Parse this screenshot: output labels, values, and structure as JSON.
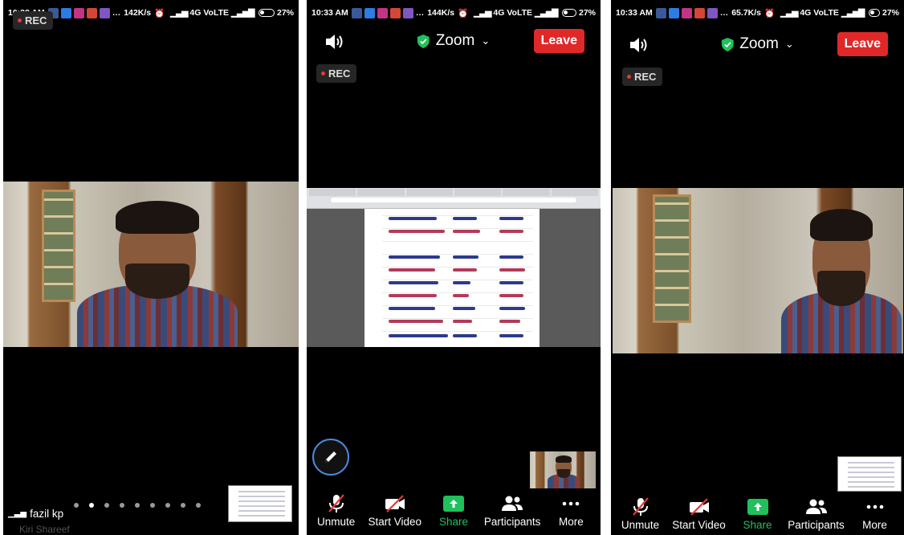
{
  "phones": {
    "left": {
      "status": {
        "time": "10:33 AM",
        "speed": "142K/s",
        "network": "4G VoLTE",
        "battery": "27%"
      },
      "rec": "REC",
      "participant_name": "fazil kp",
      "partial_name": "Kiri Shareef",
      "page_dots": {
        "count": 9,
        "active_index": 1
      }
    },
    "middle": {
      "status": {
        "time": "10:33 AM",
        "speed": "144K/s",
        "network": "4G VoLTE",
        "battery": "27%"
      },
      "app_title": "Zoom",
      "leave_label": "Leave",
      "rec": "REC",
      "toolbar": {
        "unmute": "Unmute",
        "start_video": "Start Video",
        "share": "Share",
        "participants": "Participants",
        "more": "More"
      }
    },
    "right": {
      "status": {
        "time": "10:33 AM",
        "speed": "65.7K/s",
        "network": "4G VoLTE",
        "battery": "27%"
      },
      "app_title": "Zoom",
      "leave_label": "Leave",
      "rec": "REC",
      "toolbar": {
        "unmute": "Unmute",
        "start_video": "Start Video",
        "share": "Share",
        "participants": "Participants",
        "more": "More"
      }
    }
  },
  "icons": {
    "speaker": "speaker-icon",
    "shield": "shield-check-icon",
    "mic_muted": "mic-off-icon",
    "video_off": "video-off-icon",
    "share": "share-arrow-icon",
    "participants": "participants-icon",
    "more": "more-dots-icon",
    "pen": "pen-icon",
    "signal": "signal-icon",
    "battery": "battery-icon"
  },
  "colors": {
    "leave": "#e02828",
    "share_green": "#20c05c",
    "shield_green": "#20c05c",
    "rec_dot": "#e53935",
    "pen_ring": "#4a8be0"
  }
}
